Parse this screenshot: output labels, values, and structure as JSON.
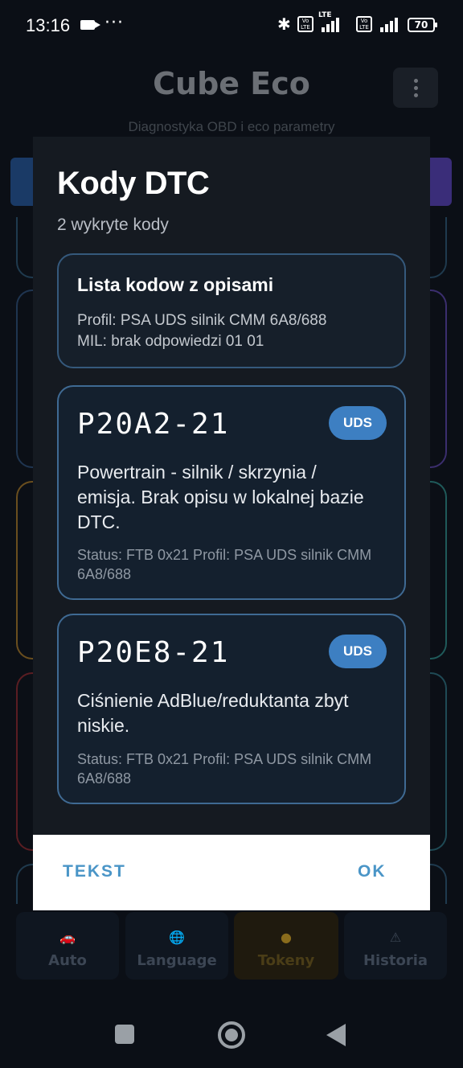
{
  "status_bar": {
    "time": "13:16",
    "battery": "70",
    "lte": "LTE"
  },
  "app": {
    "title": "Cube Eco",
    "subtitle": "Diagnostyka OBD i eco parametry"
  },
  "bottom_nav": [
    {
      "label": "Auto",
      "icon": "car-icon"
    },
    {
      "label": "Language",
      "icon": "globe-icon"
    },
    {
      "label": "Tokeny",
      "icon": "coin-icon"
    },
    {
      "label": "Historia",
      "icon": "warning-icon"
    }
  ],
  "dialog": {
    "title": "Kody DTC",
    "subtitle": "2 wykryte kody",
    "summary": {
      "heading": "Lista kodow z opisami",
      "profile": "Profil: PSA UDS silnik CMM 6A8/688",
      "mil": "MIL: brak odpowiedzi 01 01"
    },
    "codes": [
      {
        "code": "P20A2-21",
        "badge": "UDS",
        "description": "Powertrain - silnik / skrzynia / emisja. Brak opisu w lokalnej bazie DTC.",
        "meta": "Status: FTB 0x21   Profil: PSA UDS silnik CMM 6A8/688"
      },
      {
        "code": "P20E8-21",
        "badge": "UDS",
        "description": "Ciśnienie AdBlue/reduktanta zbyt niskie.",
        "meta": "Status: FTB 0x21   Profil: PSA UDS silnik CMM 6A8/688"
      }
    ],
    "buttons": {
      "text": "TEKST",
      "ok": "OK"
    }
  },
  "colors": {
    "accent": "#4a95c7",
    "badge": "#3d7fc2",
    "card_border": "#3f6a93",
    "dialog_bg": "#151a21"
  }
}
